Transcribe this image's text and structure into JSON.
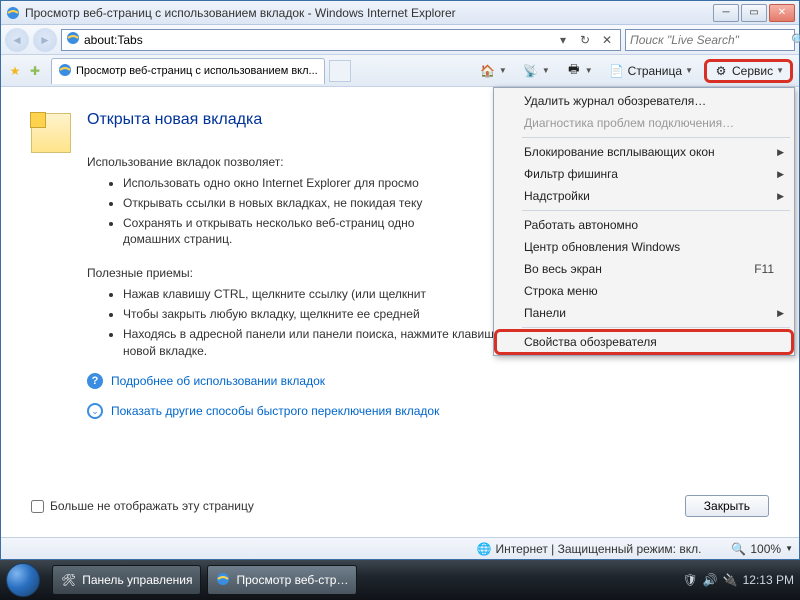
{
  "window": {
    "title": "Просмотр веб-страниц с использованием вкладок - Windows Internet Explorer"
  },
  "addressbar": {
    "url": "about:Tabs"
  },
  "searchbar": {
    "placeholder": "Поиск \"Live Search\""
  },
  "tab": {
    "label": "Просмотр веб-страниц с использованием вкл..."
  },
  "commandbar": {
    "page_label": "Страница",
    "tools_label": "Сервис"
  },
  "tools_menu": {
    "delete_history": "Удалить журнал обозревателя…",
    "diagnose": "Диагностика проблем подключения…",
    "popup_blocker": "Блокирование всплывающих окон",
    "phishing_filter": "Фильтр фишинга",
    "addons": "Надстройки",
    "work_offline": "Работать автономно",
    "windows_update": "Центр обновления Windows",
    "fullscreen": "Во весь экран",
    "fullscreen_shortcut": "F11",
    "menubar": "Строка меню",
    "toolbars": "Панели",
    "internet_options": "Свойства обозревателя"
  },
  "page": {
    "heading": "Открыта новая вкладка",
    "lead1": "Использование вкладок позволяет:",
    "b1": "Использовать одно окно Internet Explorer для просмо",
    "b2": "Открывать ссылки в новых вкладках, не покидая теку",
    "b3": "Сохранять и открывать несколько веб-страниц одно",
    "b3b": "домашних страниц.",
    "lead2": "Полезные приемы:",
    "t1": "Нажав клавишу CTRL, щелкните ссылку (или щелкнит",
    "t2": "Чтобы закрыть любую вкладку, щелкните ее средней",
    "t3": "Находясь в адресной панели или панели поиска, нажмите клавиши ALT+ВВОД, чтобы открыть результат поиска на новой вкладке.",
    "link_more": "Подробнее об использовании вкладок",
    "link_other": "Показать другие способы быстрого переключения вкладок",
    "checkbox": "Больше не отображать эту страницу",
    "close_btn": "Закрыть"
  },
  "statusbar": {
    "zone": "Интернет | Защищенный режим: вкл.",
    "zoom": "100%"
  },
  "taskbar": {
    "item1": "Панель управления",
    "item2": "Просмотр веб-стр…",
    "clock": "12:13 PM"
  }
}
